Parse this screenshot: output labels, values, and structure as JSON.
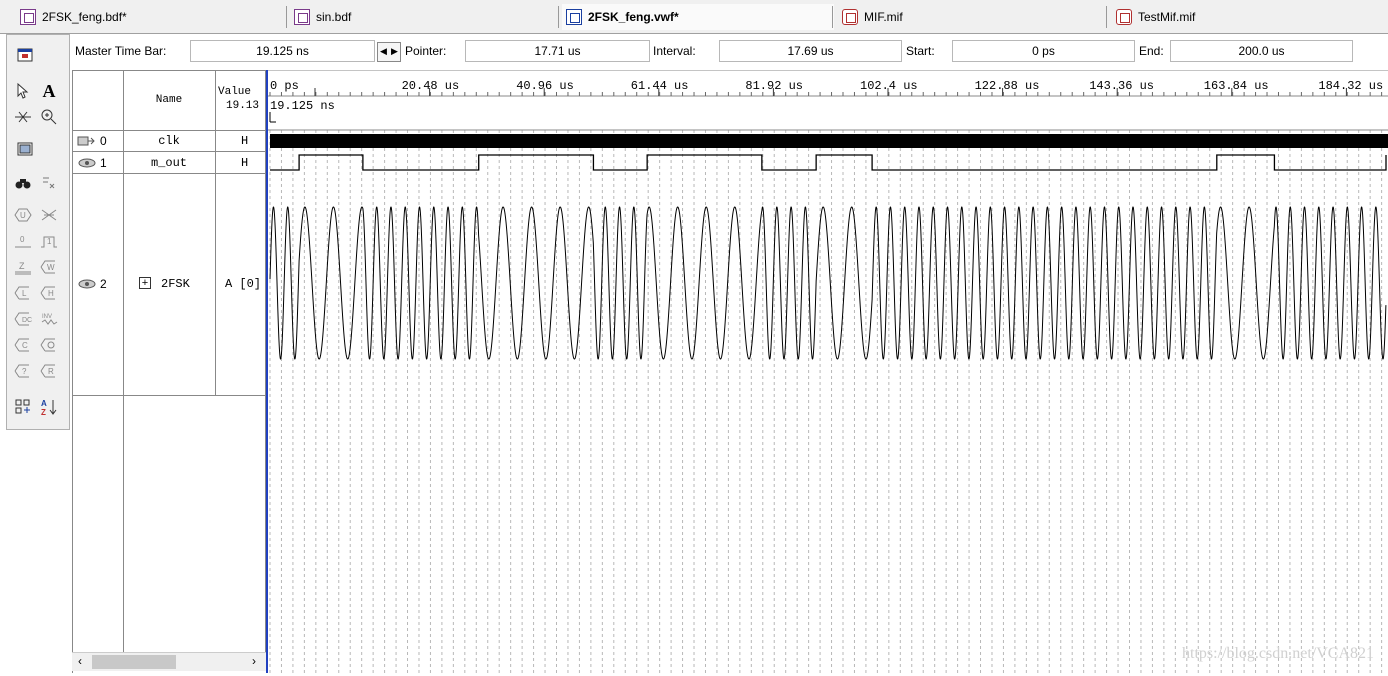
{
  "tabs": [
    {
      "label": "2FSK_feng.bdf*",
      "icon": "bdf-file-icon",
      "active": false
    },
    {
      "label": "sin.bdf",
      "icon": "bdf-file-icon",
      "active": false
    },
    {
      "label": "2FSK_feng.vwf*",
      "icon": "waveform-file-icon",
      "active": true
    },
    {
      "label": "MIF.mif",
      "icon": "mif-file-icon",
      "active": false
    },
    {
      "label": "TestMif.mif",
      "icon": "mif-file-icon",
      "active": false
    }
  ],
  "infobar": {
    "master_time_bar_label": "Master Time Bar:",
    "master_time_bar_value": "19.125 ns",
    "pointer_label": "Pointer:",
    "pointer_value": "17.71 us",
    "interval_label": "Interval:",
    "interval_value": "17.69 us",
    "start_label": "Start:",
    "start_value": "0 ps",
    "end_label": "End:",
    "end_value": "200.0 us"
  },
  "table": {
    "name_header": "Name",
    "value_header": "Value",
    "value_time": "19.13",
    "rows": [
      {
        "index": "0",
        "name": "clk",
        "value": "H"
      },
      {
        "index": "1",
        "name": "m_out",
        "value": "H"
      },
      {
        "index": "2",
        "name": "2FSK",
        "value": "A [0]",
        "expand": "+"
      }
    ]
  },
  "timeline": {
    "ticks": [
      "0 ps",
      "20.48 us",
      "40.96 us",
      "61.44 us",
      "81.92 us",
      "102.4 us",
      "122.88 us",
      "143.36 us",
      "163.84 us",
      "184.32 us"
    ],
    "cursor_label": "19.125 ns",
    "tick_spacing_us": 20.48,
    "end_us": 200.0
  },
  "signals": {
    "m_out_high_intervals_us": [
      [
        5.2,
        16.6
      ],
      [
        37.3,
        57.8
      ],
      [
        67.4,
        87.9
      ],
      [
        97.6,
        107.6
      ],
      [
        169.2,
        179.5
      ]
    ],
    "fsk_high_cycle_us": 5.1,
    "fsk_low_cycle_us": 2.55
  },
  "watermark": "https://blog.csdn.net/VCA821",
  "colors": {
    "cursor": "#2040c0",
    "grid": "#b8b8b8",
    "wave": "#000000"
  }
}
